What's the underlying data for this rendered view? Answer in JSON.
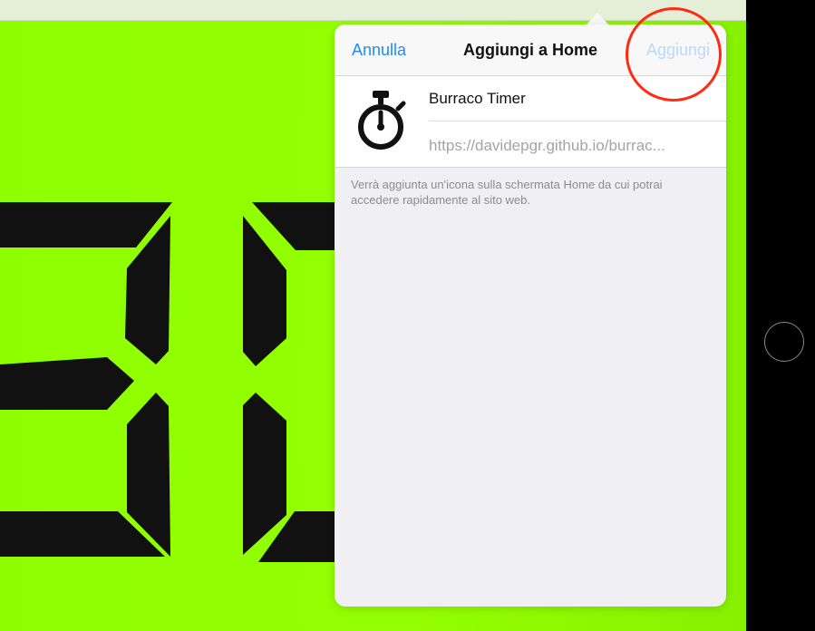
{
  "popover": {
    "cancel_label": "Annulla",
    "title": "Aggiungi a Home",
    "add_label": "Aggiungi",
    "app_name": "Burraco Timer",
    "url": "https://davidepgr.github.io/burrac...",
    "footnote": "Verrà aggiunta un'icona sulla schermata Home da cui potrai accedere rapidamente al sito web."
  },
  "icons": {
    "app_icon": "stopwatch-icon",
    "home_button": "home-button-circle"
  },
  "colors": {
    "screen_background": "#94ff00",
    "segment_color": "#111111",
    "accent_blue": "#1f8bff",
    "disabled_blue": "#bcd8f8",
    "annotation_red": "#ff2a12"
  }
}
